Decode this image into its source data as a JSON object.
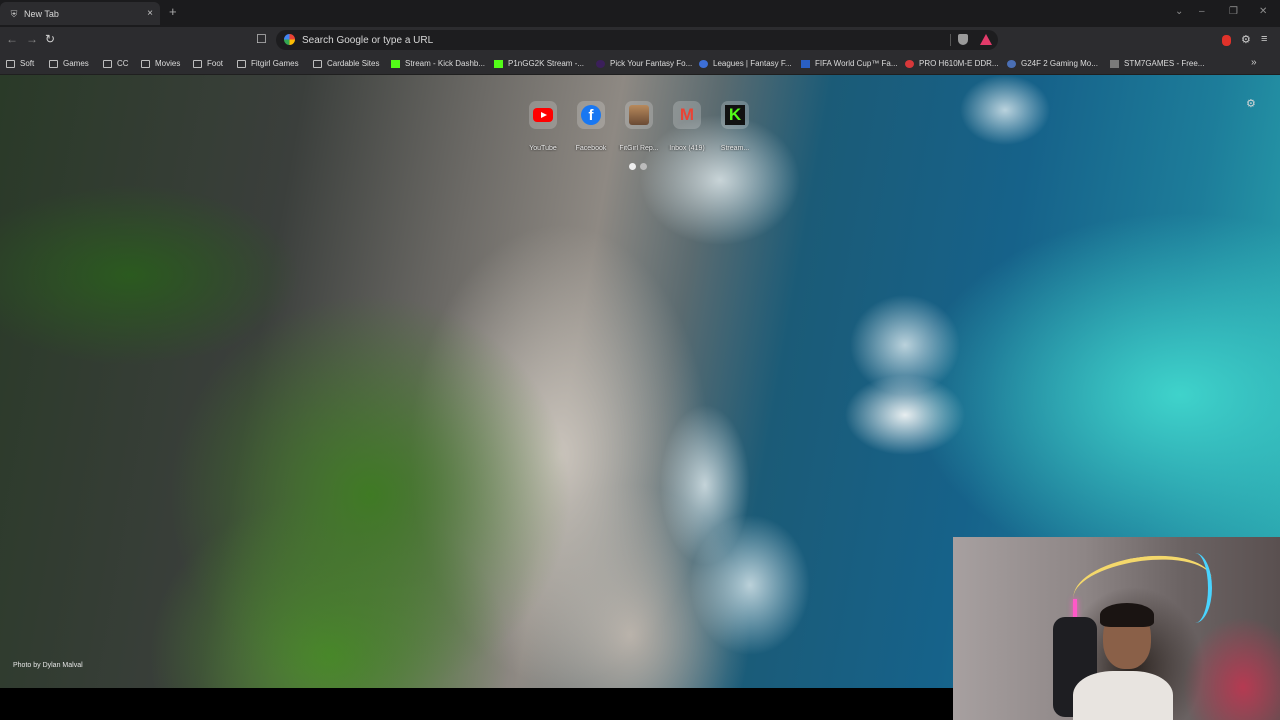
{
  "browser": {
    "tab": {
      "title": "New Tab",
      "close": "×"
    },
    "new_tab_button": "+",
    "window_controls": {
      "chevron": "⌄",
      "minimize": "–",
      "restore": "❐",
      "close": "✕"
    },
    "nav": {
      "back": "←",
      "forward": "→",
      "reload": "↻"
    },
    "bookmark_page_icon": "☐",
    "omnibox": {
      "placeholder": "Search Google or type a URL",
      "value": ""
    },
    "toolbar_right": {
      "extensions": "⚙",
      "menu": "≡"
    }
  },
  "bookmarks": [
    {
      "label": "Soft",
      "type": "folder"
    },
    {
      "label": "Games",
      "type": "folder"
    },
    {
      "label": "CC",
      "type": "folder"
    },
    {
      "label": "Movies",
      "type": "folder"
    },
    {
      "label": "Foot",
      "type": "folder"
    },
    {
      "label": "Fitgirl Games",
      "type": "folder"
    },
    {
      "label": "Cardable Sites",
      "type": "folder"
    },
    {
      "label": "Stream - Kick Dashb...",
      "type": "kick"
    },
    {
      "label": "P1nGG2K Stream -...",
      "type": "kick"
    },
    {
      "label": "Pick Your Fantasy Fo...",
      "type": "site"
    },
    {
      "label": "Leagues | Fantasy F...",
      "type": "site"
    },
    {
      "label": "FIFA World Cup™ Fa...",
      "type": "site"
    },
    {
      "label": "PRO H610M-E DDR...",
      "type": "site"
    },
    {
      "label": "G24F 2 Gaming Mo...",
      "type": "site"
    },
    {
      "label": "STM7GAMES - Free...",
      "type": "site"
    }
  ],
  "bookmarks_overflow": "»",
  "shortcuts": [
    {
      "label": "YouTube",
      "icon": "youtube-icon"
    },
    {
      "label": "Facebook",
      "icon": "facebook-icon",
      "glyph": "f"
    },
    {
      "label": "FitGirl Rep...",
      "icon": "fitgirl-icon"
    },
    {
      "label": "Inbox (419)",
      "icon": "gmail-icon",
      "glyph": "M"
    },
    {
      "label": "Stream...",
      "icon": "kick-icon",
      "glyph": "K"
    }
  ],
  "customize_icon": "⚙",
  "photo_credit": "Photo by Dylan Malval",
  "colors": {
    "tab_active": "#2c2c2f",
    "toolbar": "#2c2c2f",
    "kick_green": "#53fc18",
    "youtube_red": "#ff0000",
    "facebook_blue": "#1877f2"
  }
}
